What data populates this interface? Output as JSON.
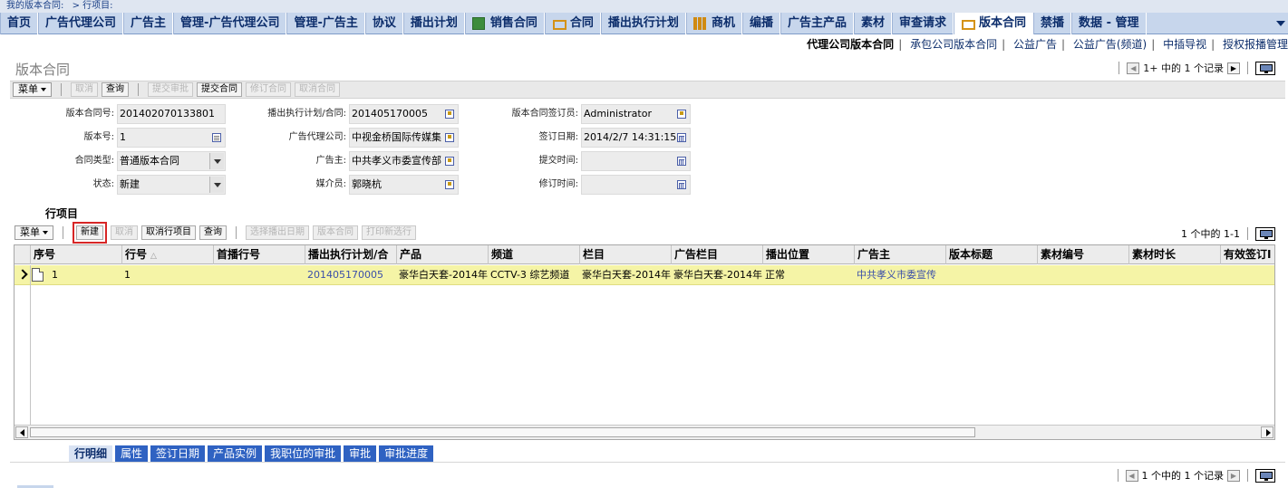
{
  "breadcrumb": [
    "我的版本合同:",
    "> 行项目:"
  ],
  "nav": {
    "tabs": [
      {
        "label": "首页",
        "icon": ""
      },
      {
        "label": "广告代理公司",
        "icon": ""
      },
      {
        "label": "广告主",
        "icon": ""
      },
      {
        "label": "管理-广告代理公司",
        "icon": ""
      },
      {
        "label": "管理-广告主",
        "icon": ""
      },
      {
        "label": "协议",
        "icon": ""
      },
      {
        "label": "播出计划",
        "icon": ""
      },
      {
        "label": "销售合同",
        "icon": "document-icon"
      },
      {
        "label": "合同",
        "icon": "cart-icon"
      },
      {
        "label": "播出执行计划",
        "icon": ""
      },
      {
        "label": "商机",
        "icon": "bar-chart-icon"
      },
      {
        "label": "编播",
        "icon": ""
      },
      {
        "label": "广告主产品",
        "icon": ""
      },
      {
        "label": "素材",
        "icon": ""
      },
      {
        "label": "审查请求",
        "icon": ""
      },
      {
        "label": "版本合同",
        "icon": "cart-icon",
        "active": true
      },
      {
        "label": "禁播",
        "icon": ""
      },
      {
        "label": "数据 - 管理",
        "icon": ""
      }
    ]
  },
  "sublinks": [
    "代理公司版本合同",
    "承包公司版本合同",
    "公益广告",
    "公益广告(频道)",
    "中插导视",
    "授权报播管理"
  ],
  "page_title": "版本合同",
  "top_records": "1+ 中的 1 个记录",
  "toolbar": {
    "menu": "菜单",
    "buttons": [
      {
        "label": "取消",
        "enabled": false
      },
      {
        "label": "查询",
        "enabled": true
      },
      {
        "label": "提交审批",
        "enabled": false
      },
      {
        "label": "提交合同",
        "enabled": true
      },
      {
        "label": "修订合同",
        "enabled": false
      },
      {
        "label": "取消合同",
        "enabled": false
      }
    ]
  },
  "form": {
    "contract_no_label": "版本合同号:",
    "contract_no": "201402070133801",
    "version_label": "版本号:",
    "version": "1",
    "contract_type_label": "合同类型:",
    "contract_type": "普通版本合同",
    "status_label": "状态:",
    "status": "新建",
    "plan_label": "播出执行计划/合同:",
    "plan": "201405170005",
    "agency_label": "广告代理公司:",
    "agency": "中视金桥国际传媒集",
    "advertiser_label": "广告主:",
    "advertiser": "中共孝义市委宣传部",
    "media_label": "媒介员:",
    "media": "郭晓杭",
    "signer_label": "版本合同签订员:",
    "signer": "Administrator",
    "sign_date_label": "签订日期:",
    "sign_date": "2014/2/7 14:31:15",
    "submit_time_label": "提交时间:",
    "submit_time": "",
    "revise_time_label": "修订时间:",
    "revise_time": ""
  },
  "line_items": {
    "title": "行项目",
    "menu": "菜单",
    "buttons": [
      {
        "label": "新建",
        "enabled": true,
        "highlighted": true
      },
      {
        "label": "取消",
        "enabled": false
      },
      {
        "label": "取消行项目",
        "enabled": true
      },
      {
        "label": "查询",
        "enabled": true
      },
      {
        "label": "选择播出日期",
        "enabled": false
      },
      {
        "label": "版本合同",
        "enabled": false
      },
      {
        "label": "打印新选行",
        "enabled": false
      }
    ],
    "records": "1 个中的 1-1",
    "columns": [
      "序号",
      "行号",
      "首播行号",
      "播出执行计划/合",
      "产品",
      "频道",
      "栏目",
      "广告栏目",
      "播出位置",
      "广告主",
      "版本标题",
      "素材编号",
      "素材时长",
      "有效签订I"
    ],
    "sorted_column": "行号",
    "rows": [
      {
        "seq": "1",
        "line": "1",
        "first_line": "",
        "plan": "201405170005",
        "product": "豪华白天套-2014年",
        "channel": "CCTV-3 综艺频道",
        "program": "豪华白天套-2014年",
        "ad_program": "豪华白天套-2014年",
        "position": "正常",
        "advertiser": "中共孝义市委宣传",
        "title": "",
        "material_no": "",
        "duration": "",
        "valid": ""
      }
    ]
  },
  "bottom_tabs": [
    {
      "label": "行明细",
      "active": true
    },
    {
      "label": "属性"
    },
    {
      "label": "签订日期"
    },
    {
      "label": "产品实例"
    },
    {
      "label": "我职位的审批"
    },
    {
      "label": "审批"
    },
    {
      "label": "审批进度"
    }
  ],
  "bottom_records": "1 个中的 1 个记录"
}
